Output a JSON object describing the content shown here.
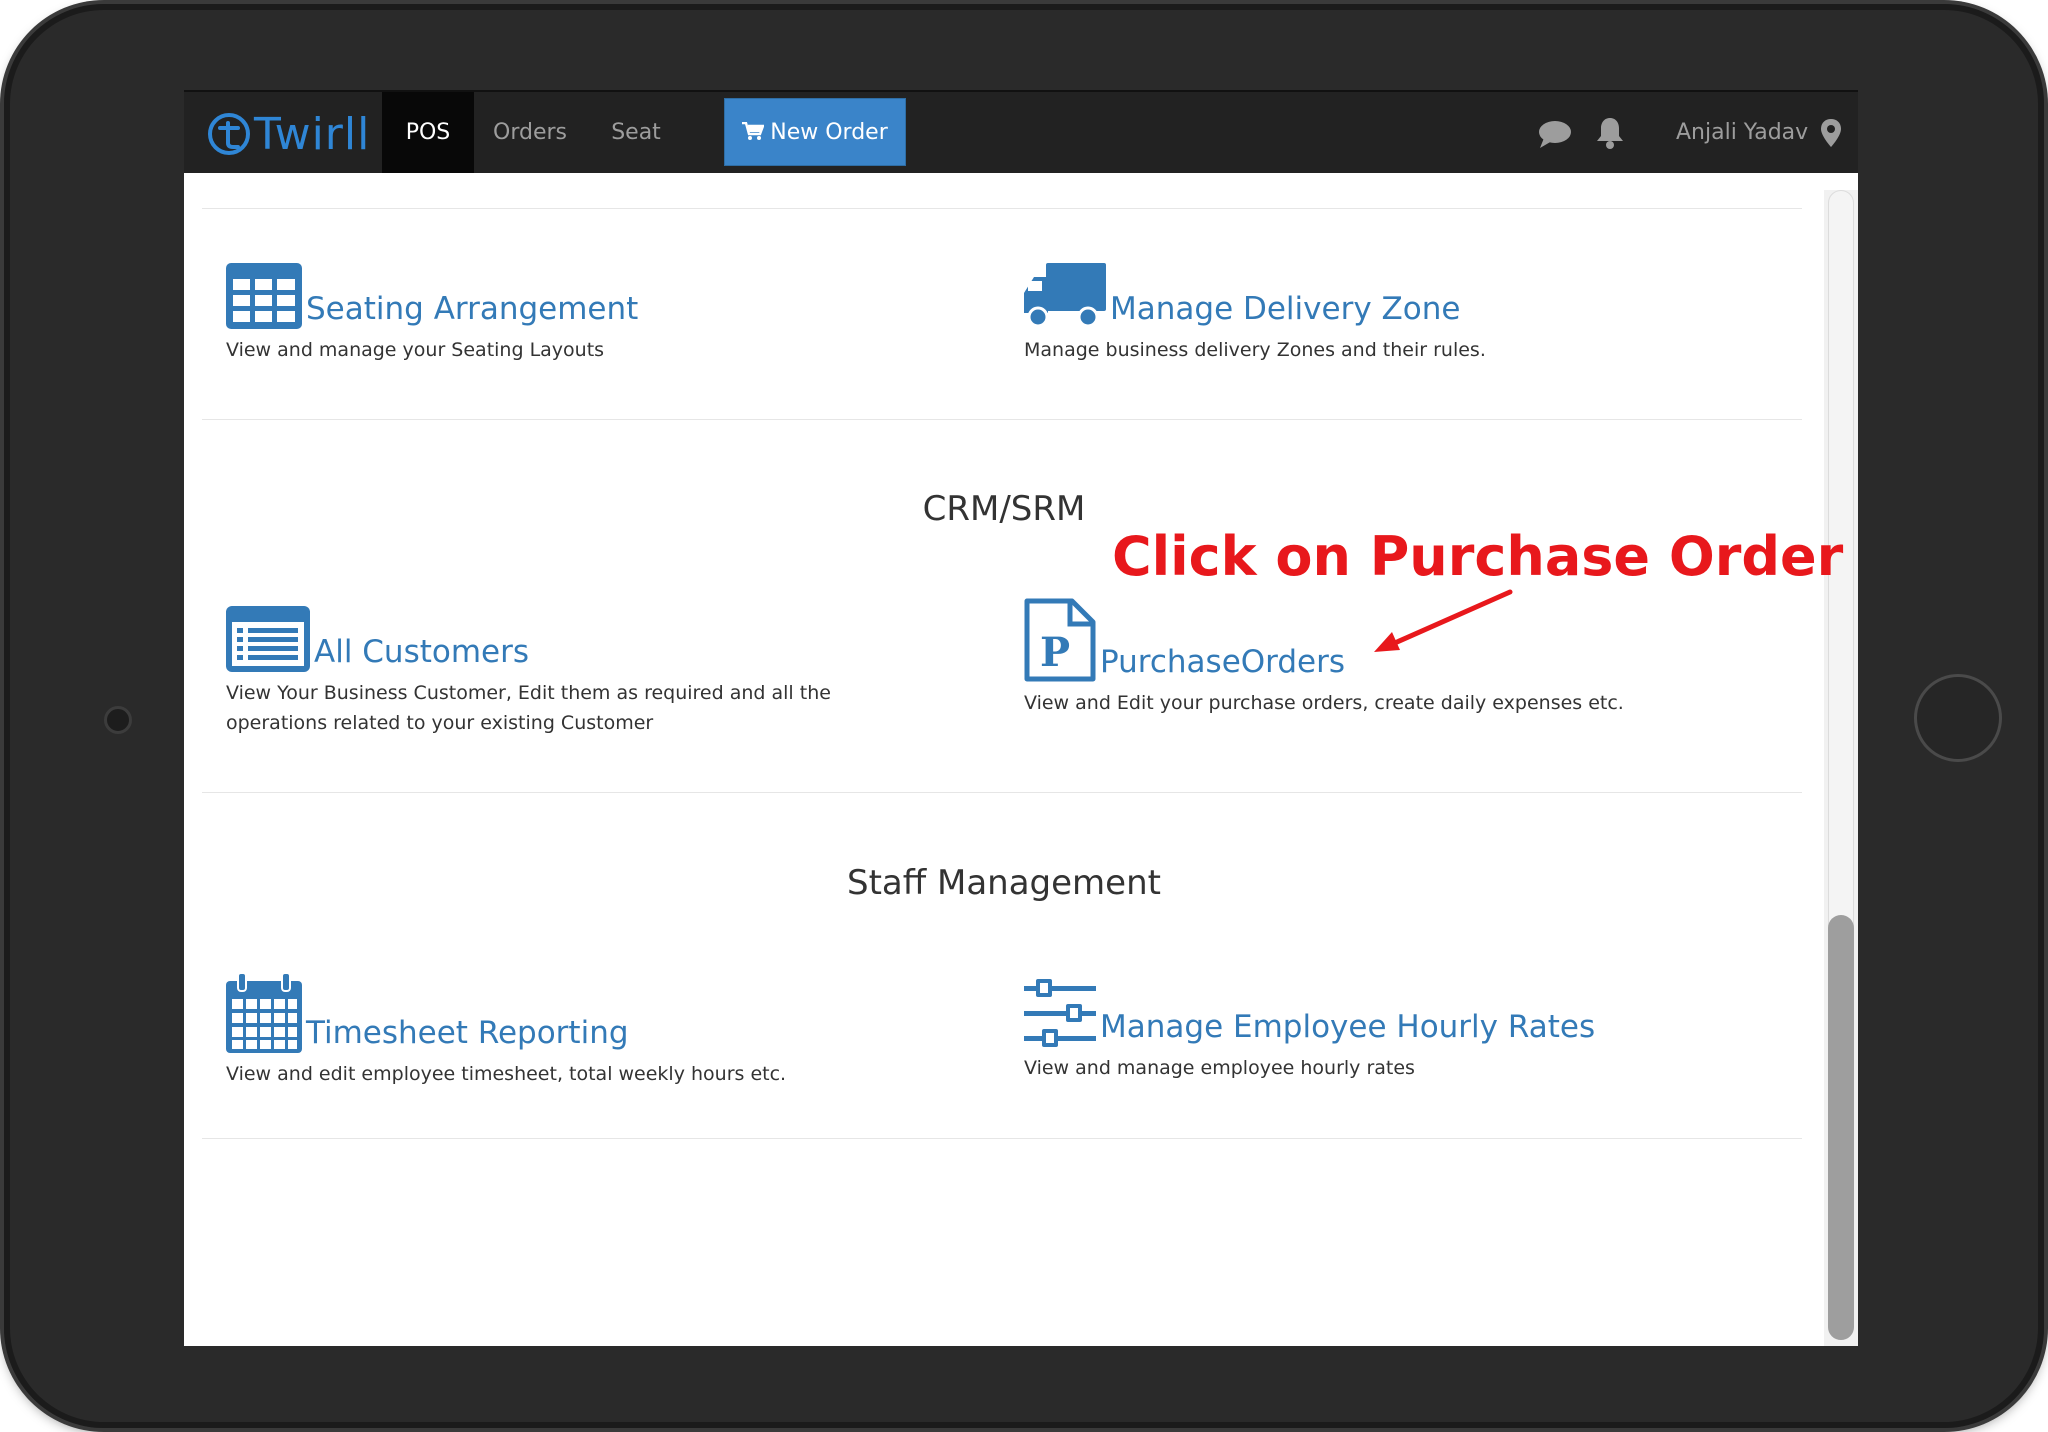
{
  "navbar": {
    "logo_text": "Twirll",
    "items": [
      {
        "label": "POS",
        "active": true
      },
      {
        "label": "Orders",
        "active": false
      },
      {
        "label": "Seat",
        "active": false
      }
    ],
    "new_order_label": "New Order",
    "user_name": "Anjali Yadav",
    "icons": [
      "cart-icon",
      "chat-icon",
      "bell-icon",
      "location-pin-icon"
    ]
  },
  "cards_top": [
    {
      "title": "Seating Arrangement",
      "desc": "View and manage your Seating Layouts",
      "icon": "table-grid-icon"
    },
    {
      "title": "Manage Delivery Zone",
      "desc": "Manage business delivery Zones and their rules.",
      "icon": "truck-icon"
    }
  ],
  "crm": {
    "title": "CRM/SRM",
    "cards": [
      {
        "title": "All Customers",
        "desc_line1": "View Your Business Customer, Edit them as required and all the",
        "desc_line2": "operations related to your existing Customer",
        "icon": "list-icon"
      },
      {
        "title": "PurchaseOrders",
        "desc": "View and Edit your purchase orders, create daily expenses etc.",
        "icon": "purchase-doc-icon"
      }
    ]
  },
  "staff": {
    "title": "Staff Management",
    "cards": [
      {
        "title": "Timesheet Reporting",
        "desc": "View and edit employee timesheet, total weekly hours etc.",
        "icon": "calendar-icon"
      },
      {
        "title": "Manage Employee Hourly Rates",
        "desc": "View and manage employee hourly rates",
        "icon": "sliders-icon"
      }
    ]
  },
  "annotation": {
    "text": "Click on Purchase Order",
    "color": "#e8181c"
  },
  "colors": {
    "accent": "#337ab7",
    "navbar": "#222222",
    "button": "#3a84c9"
  }
}
